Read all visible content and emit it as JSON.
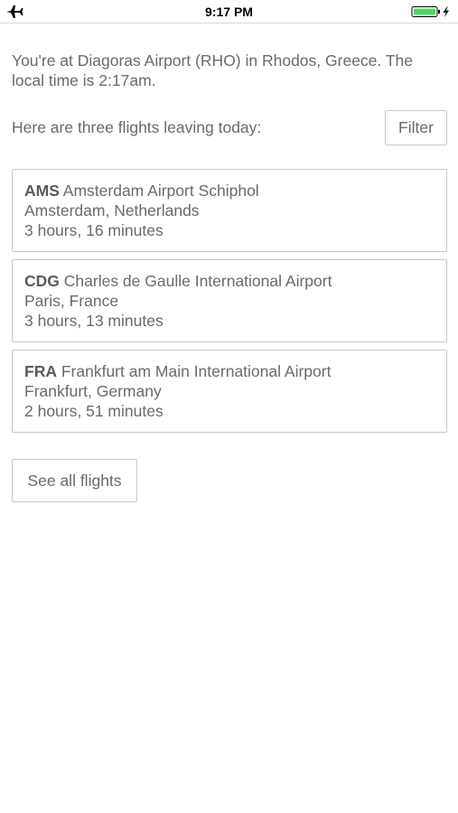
{
  "status_bar": {
    "time": "9:17 PM",
    "left_icon": "airplane-icon",
    "right_icons": [
      "battery-icon",
      "charging-bolt-icon"
    ]
  },
  "intro": {
    "text": "You're at Diagoras Airport (RHO) in Rhodos, Greece. The local time is 2:17am."
  },
  "flights_section": {
    "heading": "Here are three flights leaving today:",
    "filter_label": "Filter"
  },
  "flights": [
    {
      "code": "AMS",
      "airport": "Amsterdam Airport Schiphol",
      "city": "Amsterdam, Netherlands",
      "duration": "3 hours, 16 minutes"
    },
    {
      "code": "CDG",
      "airport": "Charles de Gaulle International Airport",
      "city": "Paris, France",
      "duration": "3 hours, 13 minutes"
    },
    {
      "code": "FRA",
      "airport": "Frankfurt am Main International Airport",
      "city": "Frankfurt, Germany",
      "duration": "2 hours, 51 minutes"
    }
  ],
  "see_all_label": "See all flights",
  "colors": {
    "text": "#6a6a6a",
    "border": "#c9c9c9",
    "battery": "#4cd964"
  }
}
